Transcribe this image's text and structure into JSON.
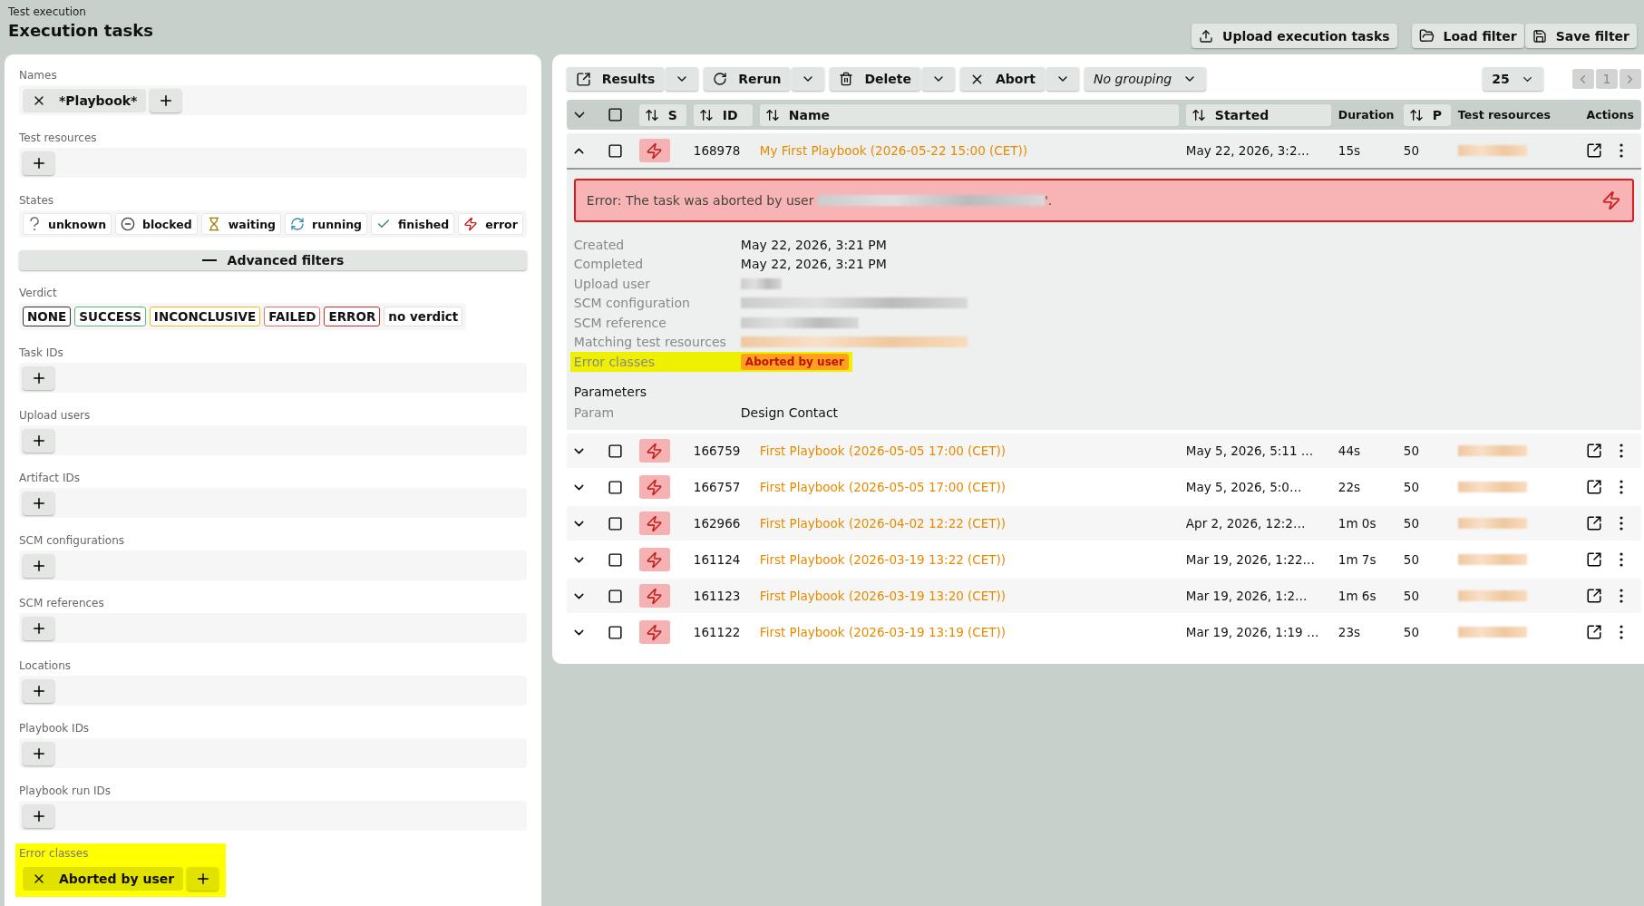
{
  "breadcrumb": "Test execution",
  "title": "Execution tasks",
  "header_buttons": [
    {
      "kind": "upload",
      "label": "Upload execution tasks"
    },
    {
      "kind": "load",
      "label": "Load filter"
    },
    {
      "kind": "save",
      "label": "Save filter"
    }
  ],
  "filters": [
    {
      "kind": "chips",
      "label": "Names",
      "chips": [
        "*Playbook*"
      ],
      "highlighted": false
    },
    {
      "kind": "chips",
      "label": "Test resources",
      "highlighted": false
    },
    {
      "kind": "states",
      "label": "States",
      "states": [
        {
          "kind": "unknown",
          "label": "unknown"
        },
        {
          "kind": "blocked",
          "label": "blocked"
        },
        {
          "kind": "waiting",
          "label": "waiting"
        },
        {
          "kind": "running",
          "label": "running"
        },
        {
          "kind": "finished",
          "label": "finished"
        },
        {
          "kind": "error",
          "label": "error"
        }
      ]
    },
    {
      "kind": "toggle",
      "label": "Advanced filters",
      "expanded": true
    },
    {
      "kind": "verdict",
      "label": "Verdict",
      "verdicts": [
        {
          "label": "NONE",
          "color": "#333333"
        },
        {
          "label": "SUCCESS",
          "color": "#5cb87a"
        },
        {
          "label": "INCONCLUSIVE",
          "color": "#e8c020"
        },
        {
          "label": "FAILED",
          "color": "#e87070"
        },
        {
          "label": "ERROR",
          "color": "#c83030"
        },
        {
          "label": "no verdict",
          "color": "#e0e0e0"
        }
      ]
    },
    {
      "kind": "chips",
      "label": "Task IDs",
      "highlighted": false
    },
    {
      "kind": "chips",
      "label": "Upload users",
      "highlighted": false
    },
    {
      "kind": "chips",
      "label": "Artifact IDs",
      "highlighted": false
    },
    {
      "kind": "chips",
      "label": "SCM configurations",
      "highlighted": false
    },
    {
      "kind": "chips",
      "label": "SCM references",
      "highlighted": false
    },
    {
      "kind": "chips",
      "label": "Locations",
      "highlighted": false
    },
    {
      "kind": "chips",
      "label": "Playbook IDs",
      "highlighted": false
    },
    {
      "kind": "chips",
      "label": "Playbook run IDs",
      "highlighted": false
    },
    {
      "kind": "chips",
      "label": "Error classes",
      "chips": [
        "Aborted by user"
      ],
      "highlighted": true
    }
  ],
  "toolbar": [
    {
      "kind": "results",
      "label": "Results"
    },
    {
      "kind": "rerun",
      "label": "Rerun"
    },
    {
      "kind": "delete",
      "label": "Delete"
    },
    {
      "kind": "abort",
      "label": "Abort"
    }
  ],
  "grouping": "No grouping",
  "page_size": "25",
  "page": "1",
  "select_all": {
    "checked": false
  },
  "columns": [
    {
      "label": "S",
      "sortable": true
    },
    {
      "label": "ID",
      "sortable": true
    },
    {
      "label": "Name",
      "sortable": true
    },
    {
      "label": "Started",
      "sortable": true
    },
    {
      "label": "Duration",
      "sortable": false
    },
    {
      "label": "P",
      "sortable": true
    },
    {
      "label": "Test resources",
      "sortable": false
    },
    {
      "label": "Actions",
      "sortable": false
    }
  ],
  "rows": [
    {
      "expanded": true,
      "checked": false,
      "id": "168978",
      "name": "My First Playbook (2026-05-22 15:00 (CET))",
      "started": "May 22, 2026, 3:2…",
      "duration": "15s",
      "p": "50",
      "details": {
        "error_text": "Error: The task was aborted by user",
        "error_end": "'.",
        "fields": [
          {
            "kind": "text",
            "label": "Created",
            "value": "May 22, 2026, 3:21 PM",
            "highlighted": false
          },
          {
            "kind": "text",
            "label": "Completed",
            "value": "May 22, 2026, 3:21 PM",
            "highlighted": false
          },
          {
            "kind": "blurred",
            "label": "Upload user",
            "highlighted": false
          },
          {
            "kind": "blurred",
            "label": "SCM configuration",
            "highlighted": false
          },
          {
            "kind": "blurred",
            "label": "SCM reference",
            "highlighted": false
          },
          {
            "kind": "blurred_link",
            "label": "Matching test resources",
            "highlighted": false
          },
          {
            "kind": "badge",
            "label": "Error classes",
            "value": "Aborted by user",
            "highlighted": true
          }
        ],
        "parameters_title": "Parameters",
        "parameters": [
          {
            "label": "Param",
            "value": "Design Contact"
          }
        ]
      }
    },
    {
      "expanded": false,
      "checked": false,
      "id": "166759",
      "name": "First Playbook (2026-05-05 17:00 (CET))",
      "started": "May 5, 2026, 5:11 …",
      "duration": "44s",
      "p": "50"
    },
    {
      "expanded": false,
      "checked": false,
      "id": "166757",
      "name": "First Playbook (2026-05-05 17:00 (CET))",
      "started": "May 5, 2026, 5:0…",
      "duration": "22s",
      "p": "50"
    },
    {
      "expanded": false,
      "checked": false,
      "id": "162966",
      "name": "First Playbook (2026-04-02 12:22 (CET))",
      "started": "Apr 2, 2026, 12:2…",
      "duration": "1m 0s",
      "p": "50"
    },
    {
      "expanded": false,
      "checked": false,
      "id": "161124",
      "name": "First Playbook (2026-03-19 13:22 (CET))",
      "started": "Mar 19, 2026, 1:22…",
      "duration": "1m 7s",
      "p": "50"
    },
    {
      "expanded": false,
      "checked": false,
      "id": "161123",
      "name": "First Playbook (2026-03-19 13:20 (CET))",
      "started": "Mar 19, 2026, 1:2…",
      "duration": "1m 6s",
      "p": "50"
    },
    {
      "expanded": false,
      "checked": false,
      "id": "161122",
      "name": "First Playbook (2026-03-19 13:19 (CET))",
      "started": "Mar 19, 2026, 1:19 …",
      "duration": "23s",
      "p": "50"
    }
  ]
}
